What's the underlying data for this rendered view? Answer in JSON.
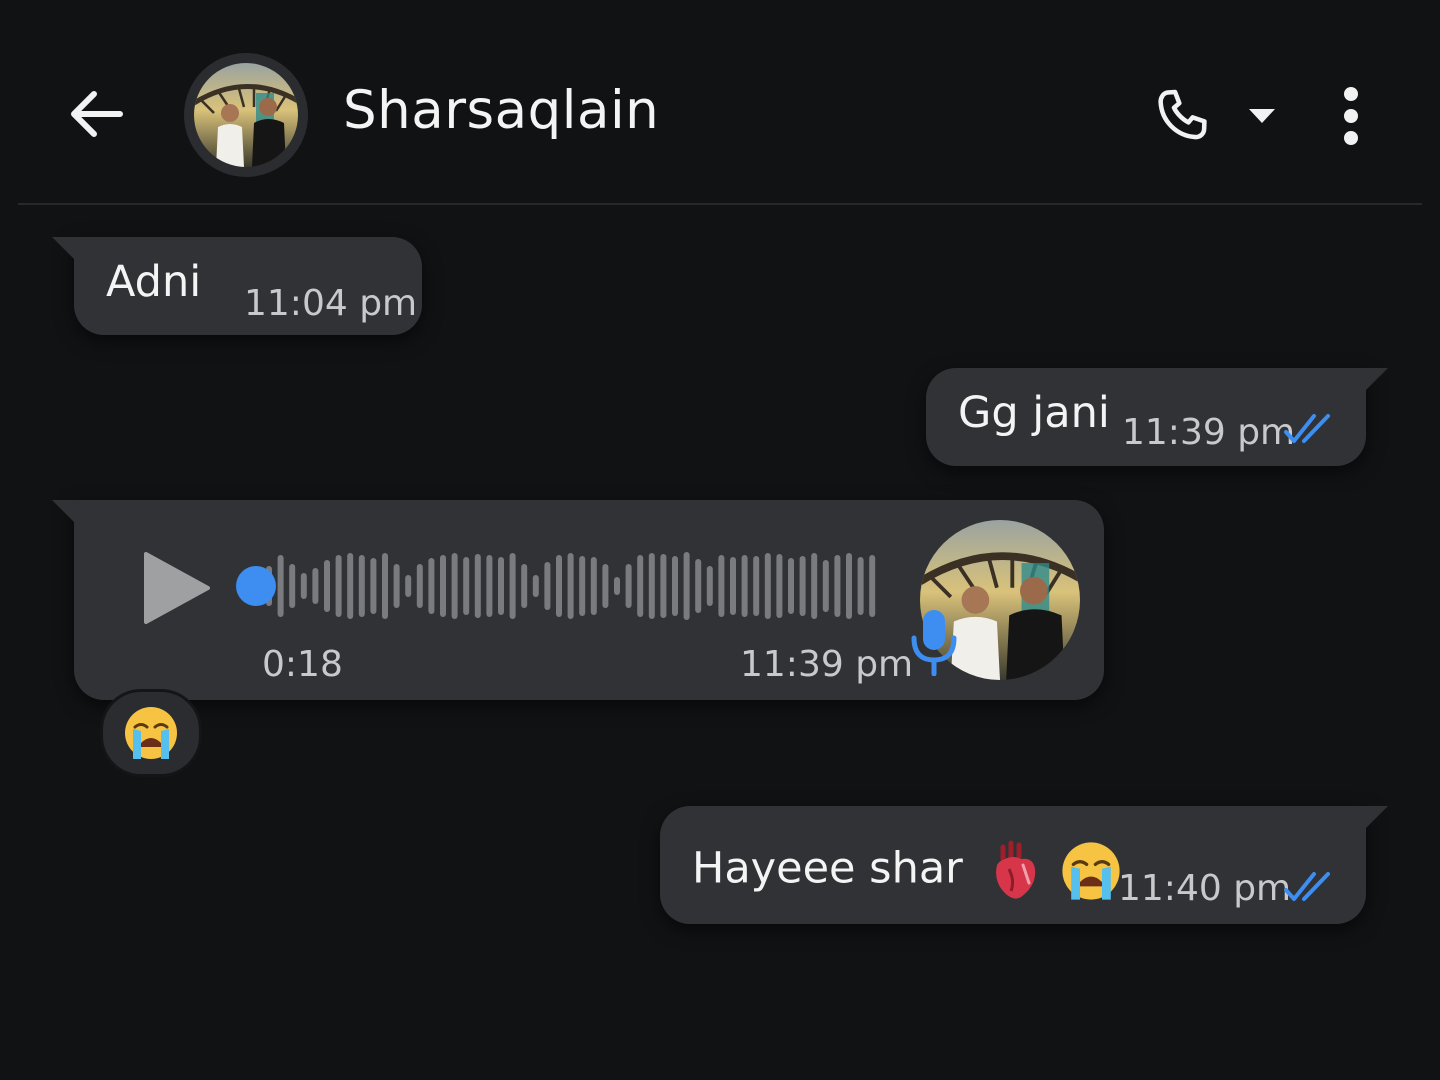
{
  "header": {
    "contact_name": "Sharsaqlain"
  },
  "messages": [
    {
      "direction": "incoming",
      "text": "Adni",
      "time": "11:04 pm"
    },
    {
      "direction": "outgoing",
      "text": "Gg jani",
      "time": "11:39 pm",
      "status": "read"
    },
    {
      "direction": "incoming",
      "type": "voice",
      "duration": "0:18",
      "time": "11:39 pm",
      "playback_progress": 0
    },
    {
      "direction": "outgoing",
      "text": "Hayeee shar",
      "emojis": [
        "anatomical-heart",
        "loudly-crying-face"
      ],
      "time": "11:40 pm",
      "status": "read"
    }
  ],
  "reaction": {
    "emoji": "loudly-crying-face",
    "on_message": 2
  },
  "colors": {
    "background": "#111214",
    "bubble": "#303235",
    "read_ticks": "#3d8ef0",
    "accent": "#3d8ef0",
    "waveform": "#7a7b7e"
  }
}
